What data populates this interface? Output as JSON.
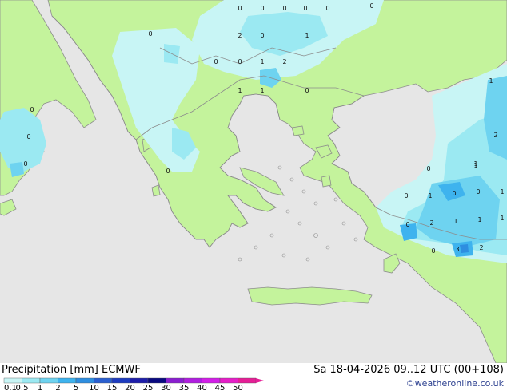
{
  "footer": {
    "title": "Precipitation [mm]  ECMWF",
    "valid": "Sa 18-04-2026 09..12 UTC (00+108)",
    "credit": "©weatheronline.co.uk"
  },
  "colors": {
    "sea": "#e6e6e6",
    "land": "#c4f39c",
    "coast": "#8c8c8c",
    "p01": "#c8f5f5",
    "p05": "#9be9f2",
    "p1": "#6ed3f0",
    "p2": "#3eb3ee",
    "p5": "#2e8ee0",
    "p10": "#2a5fd0"
  },
  "legend": {
    "labels": [
      "0.1",
      "0.5",
      "1",
      "2",
      "5",
      "10",
      "15",
      "20",
      "25",
      "30",
      "35",
      "40",
      "45",
      "50"
    ],
    "colors": [
      "#c8f5f5",
      "#9be9f2",
      "#6ed3f0",
      "#3eb3ee",
      "#2e8ee0",
      "#2a5fd0",
      "#1e3cc0",
      "#1e1eaa",
      "#0a0a80",
      "#8a1ed0",
      "#b01ee0",
      "#d21ee8",
      "#e61ec8",
      "#e61e96"
    ]
  },
  "map_numbers": [
    "0",
    "0",
    "0",
    "0",
    "0",
    "0",
    "0",
    "2",
    "0",
    "1",
    "0",
    "0",
    "1",
    "2",
    "1",
    "1",
    "0",
    "0",
    "0",
    "0",
    "0",
    "0",
    "1",
    "0",
    "0",
    "1",
    "0",
    "2",
    "1",
    "1",
    "0",
    "3",
    "2",
    "2",
    "1",
    "1",
    "1",
    "0",
    "1"
  ]
}
